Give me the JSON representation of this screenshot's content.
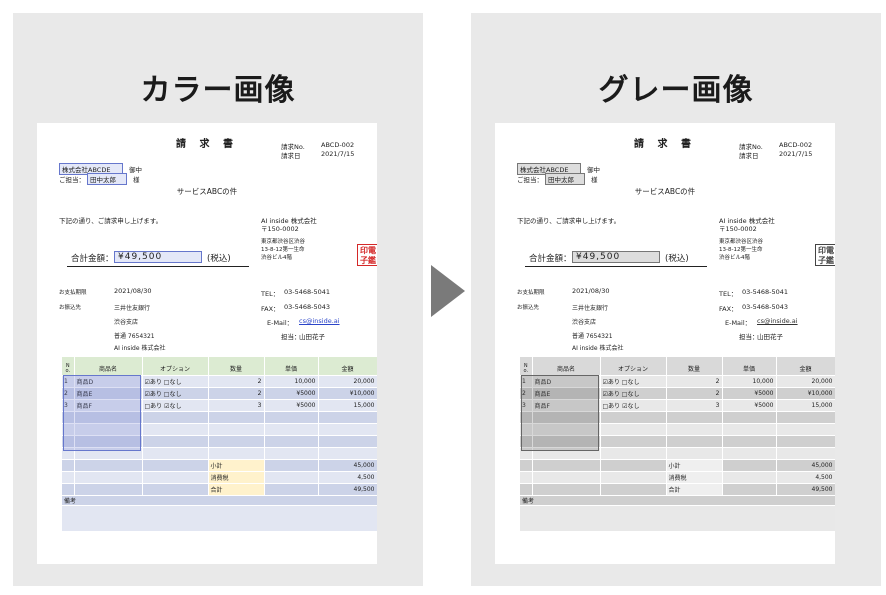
{
  "panels": {
    "left_title": "カラー画像",
    "right_title": "グレー画像"
  },
  "invoice": {
    "title": "請 求 書",
    "no_label": "請求No.",
    "no_value": "ABCD-002",
    "date_label": "請求日",
    "date_value": "2021/7/15",
    "recipient_company": "株式会社ABCDE",
    "recipient_honorific": "御中",
    "contact_label": "ご担当：",
    "contact_name": "田中太郎",
    "contact_honorific": "様",
    "subject": "サービスABCの件",
    "intro": "下記の通り、ご請求申し上げます。",
    "total_label": "合計金額：",
    "total_value": "¥49,500",
    "total_tax": "(税込)",
    "issuer_name": "AI inside 株式会社",
    "issuer_zip": "〒150-0002",
    "issuer_addr1": "東京都渋谷区渋谷",
    "issuer_addr2": "13-8-12第一生命",
    "issuer_addr3": "渋谷ビル4階",
    "stamp_text": "印電子鑑",
    "due_label": "お支払期限",
    "due_value": "2021/08/30",
    "bank_label": "お振込先",
    "bank_name": "三井住友銀行",
    "bank_branch": "渋谷支店",
    "bank_account": "普通  7654321",
    "bank_holder": "AI inside 株式会社",
    "tel_label": "TEL：",
    "tel_value": "03-5468-5041",
    "fax_label": "FAX：",
    "fax_value": "03-5468-5043",
    "email_label": "E-Mail：",
    "email_value": "cs@inside.ai",
    "staff_label": "担当：",
    "staff_value": "山田花子"
  },
  "table": {
    "headers": [
      "N o.",
      "商品名",
      "オプション",
      "数量",
      "単価",
      "金額"
    ],
    "rows": [
      {
        "no": "1",
        "name": "商品D",
        "option": "☑あり  □なし",
        "qty": "2",
        "price": "10,000",
        "amount": "20,000"
      },
      {
        "no": "2",
        "name": "商品E",
        "option": "☑あり  □なし",
        "qty": "2",
        "price": "¥5000",
        "amount": "¥10,000"
      },
      {
        "no": "3",
        "name": "商品F",
        "option": "□あり  ☑なし",
        "qty": "3",
        "price": "¥5000",
        "amount": "15,000"
      }
    ],
    "subtotal_label": "小計",
    "subtotal_value": "45,000",
    "tax_label": "消費税",
    "tax_value": "4,500",
    "total_label": "合計",
    "total_value": "49,500",
    "remarks_label": "備考"
  },
  "colors": {
    "selection_blue": "#6677cc",
    "header_green": "#dcebd2",
    "summary_yellow": "#fff2cc",
    "stamp_red": "#d42828"
  }
}
